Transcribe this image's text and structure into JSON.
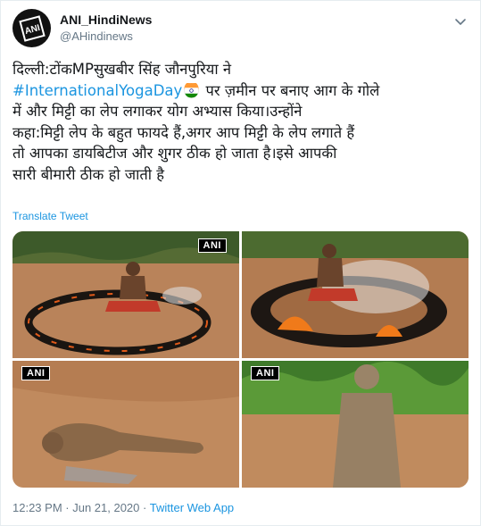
{
  "user": {
    "display_name": "ANI_HindiNews",
    "handle": "@AHindinews",
    "avatar_text": "ANI"
  },
  "tweet": {
    "line1": "दिल्ली:टोंकMPसुखबीर सिंह जौनपुरिया ने",
    "hashtag": "#InternationalYogaDay",
    "line2_rest": " पर ज़मीन पर बनाए आग के गोले",
    "line3": "में और मिट्टी का लेप लगाकर योग अभ्यास किया।उन्होंने",
    "line4": "कहा:मिट्टी लेप के बहुत फायदे हैं,अगर आप मिट्टी के लेप लगाते हैं",
    "line5": "तो आपका डायबिटीज और शुगर ठीक हो जाता है।इसे आपकी",
    "line6": "सारी बीमारी ठीक हो जाती है",
    "emoji": "india-flag-emoji"
  },
  "translate_label": "Translate Tweet",
  "media": {
    "watermark": "ANI",
    "photos": [
      {
        "name": "photo-fire-ring-meditation"
      },
      {
        "name": "photo-fire-ring-smoke"
      },
      {
        "name": "photo-lying-in-mud"
      },
      {
        "name": "photo-mud-covered-standing"
      }
    ]
  },
  "footer": {
    "time": "12:23 PM",
    "sep1": " · ",
    "date": "Jun 21, 2020",
    "sep2": " · ",
    "source": "Twitter Web App"
  },
  "colors": {
    "link": "#1b95e0",
    "secondary": "#657786",
    "text": "#14171a"
  }
}
